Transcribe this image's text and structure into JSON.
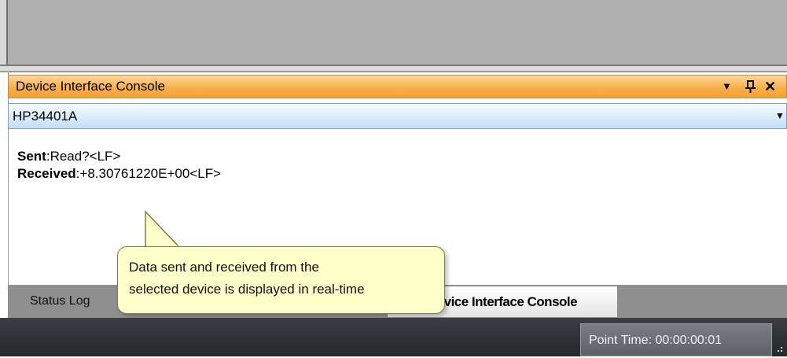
{
  "panel": {
    "title": "Device Interface Console",
    "icons": [
      "dropdown-icon",
      "pin-icon",
      "close-icon"
    ]
  },
  "device_selector": {
    "selected": "HP34401A"
  },
  "console": {
    "sent_label": "Sent",
    "sent_value": ":Read?<LF>",
    "received_label": "Received",
    "received_value": ":+8.30761220E+00<LF>"
  },
  "tabs": {
    "status_log": "Status Log",
    "device_interface_console": "Device Interface Console"
  },
  "tooltip": {
    "line1": "Data sent and received from the",
    "line2": "selected device is displayed in real-time"
  },
  "status_bar": {
    "point_time": "Point Time: 00:00:00:01"
  },
  "colors": {
    "title_bar": "#f7b04a",
    "selector": "#d9ebfa",
    "tooltip_bg": "#ffffc9",
    "status_bar": "#2f3338"
  }
}
